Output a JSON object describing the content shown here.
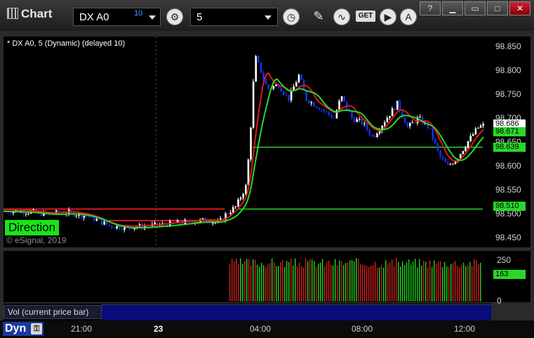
{
  "window": {
    "title": "Chart",
    "controls": {
      "min": "?",
      "restore": "▭",
      "max": "□",
      "close": "✕"
    }
  },
  "toolbar": {
    "symbol": "DX A0",
    "symbol_sup": "10",
    "interval": "5",
    "tools": [
      "settings-icon",
      "clock-icon",
      "pencil-icon",
      "study-icon",
      "get-icon",
      "play-icon",
      "alert-icon"
    ],
    "get_label": "GET"
  },
  "chart": {
    "overlay_label": "* DX A0, 5 (Dynamic) (delayed 10)",
    "direction_label": "Direction",
    "copyright": "© eSignal, 2019",
    "price_axis": [
      "98.850",
      "98.800",
      "98.750",
      "98.700",
      "98.650",
      "98.600",
      "98.550",
      "98.500",
      "98.450"
    ],
    "tags": {
      "last": "98.686",
      "ma": "98.671",
      "green_line_upper": "98.639",
      "green_line_lower": "98.510"
    },
    "colors": {
      "up_candle": "#ffffff",
      "down_candle": "#1230e8",
      "red_ma": "#e01818",
      "green_ma": "#28d828",
      "level_line": "#28d828",
      "red_level": "#e01818"
    }
  },
  "volume": {
    "axis": [
      "250",
      "0"
    ],
    "tag": "163",
    "label": "Vol (current price bar)",
    "close_label": "✕"
  },
  "time_axis": {
    "mode": "Dyn",
    "labels": [
      "21:00",
      "23",
      "04:00",
      "08:00",
      "12:00"
    ]
  },
  "chart_data": {
    "type": "candlestick",
    "instrument": "DX A0",
    "interval": "5",
    "ylim": [
      98.43,
      98.87
    ],
    "levels": [
      98.639,
      98.51,
      98.51
    ],
    "last": 98.686,
    "ma": 98.671,
    "x_ticks": [
      "21:00",
      "23",
      "04:00",
      "08:00",
      "12:00"
    ]
  }
}
